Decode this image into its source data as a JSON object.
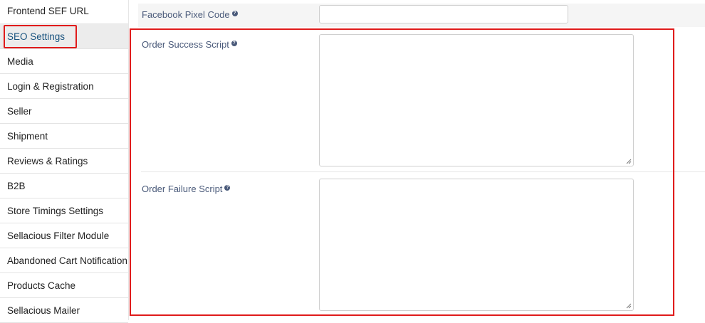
{
  "sidebar": {
    "items": [
      {
        "label": "Frontend SEF URL"
      },
      {
        "label": "SEO Settings"
      },
      {
        "label": "Media"
      },
      {
        "label": "Login & Registration"
      },
      {
        "label": "Seller"
      },
      {
        "label": "Shipment"
      },
      {
        "label": "Reviews & Ratings"
      },
      {
        "label": "B2B"
      },
      {
        "label": "Store Timings Settings"
      },
      {
        "label": "Sellacious Filter Module"
      },
      {
        "label": "Abandoned Cart Notification"
      },
      {
        "label": "Products Cache"
      },
      {
        "label": "Sellacious Mailer"
      }
    ],
    "active_index": 1
  },
  "form": {
    "facebook_pixel": {
      "label": "Facebook Pixel Code",
      "value": ""
    },
    "order_success": {
      "label": "Order Success Script",
      "value": ""
    },
    "order_failure": {
      "label": "Order Failure Script",
      "value": ""
    }
  },
  "colors": {
    "highlight": "#e01b1b",
    "label": "#4a5a7a",
    "active_text": "#1b5580"
  },
  "icons": {
    "help": "help-icon",
    "resize": "resize-grip-icon"
  }
}
